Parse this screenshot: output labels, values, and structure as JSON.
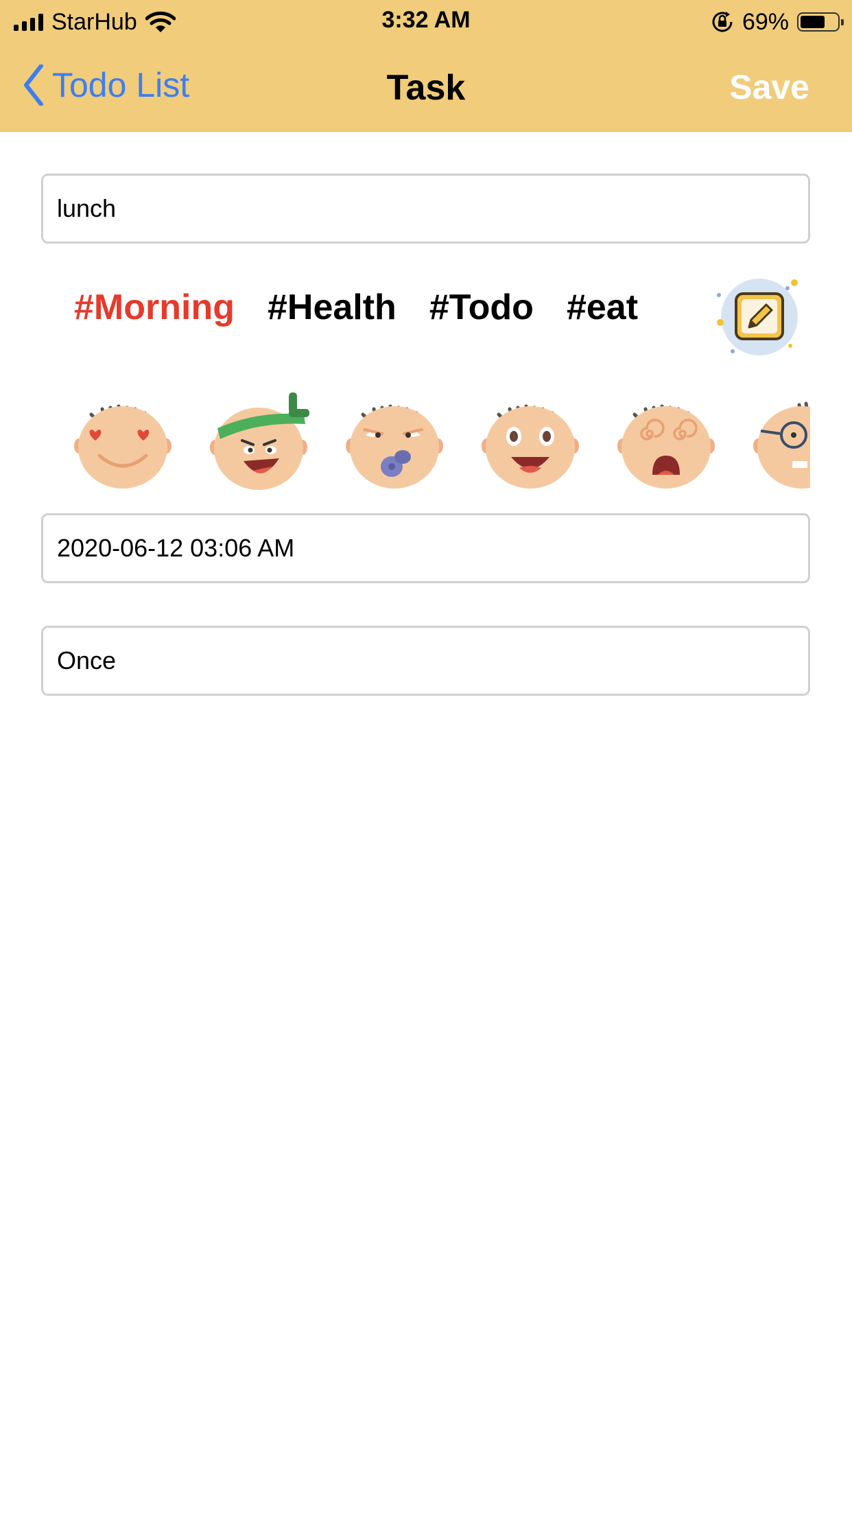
{
  "status_bar": {
    "carrier": "StarHub",
    "time": "3:32 AM",
    "battery_percent": "69%",
    "battery_level": 0.69,
    "icons": [
      "signal-icon",
      "wifi-icon",
      "rotation-lock-icon",
      "battery-icon"
    ]
  },
  "nav": {
    "back_label": "Todo List",
    "title": "Task",
    "save_label": "Save",
    "back_color": "#3d7ef0",
    "bar_color": "#f0cc7b"
  },
  "task": {
    "name": "lunch",
    "datetime": "2020-06-12 03:06 AM",
    "repeat": "Once"
  },
  "tags": [
    {
      "label": "#Morning",
      "active": true
    },
    {
      "label": "#Health",
      "active": false
    },
    {
      "label": "#Todo",
      "active": false
    },
    {
      "label": "#eat",
      "active": false
    }
  ],
  "tag_active_color": "#e53b2c",
  "emoji_faces": [
    "heart-eyes-face-icon",
    "headband-face-icon",
    "pacifier-face-icon",
    "surprised-face-icon",
    "dizzy-face-icon",
    "glasses-face-icon"
  ]
}
